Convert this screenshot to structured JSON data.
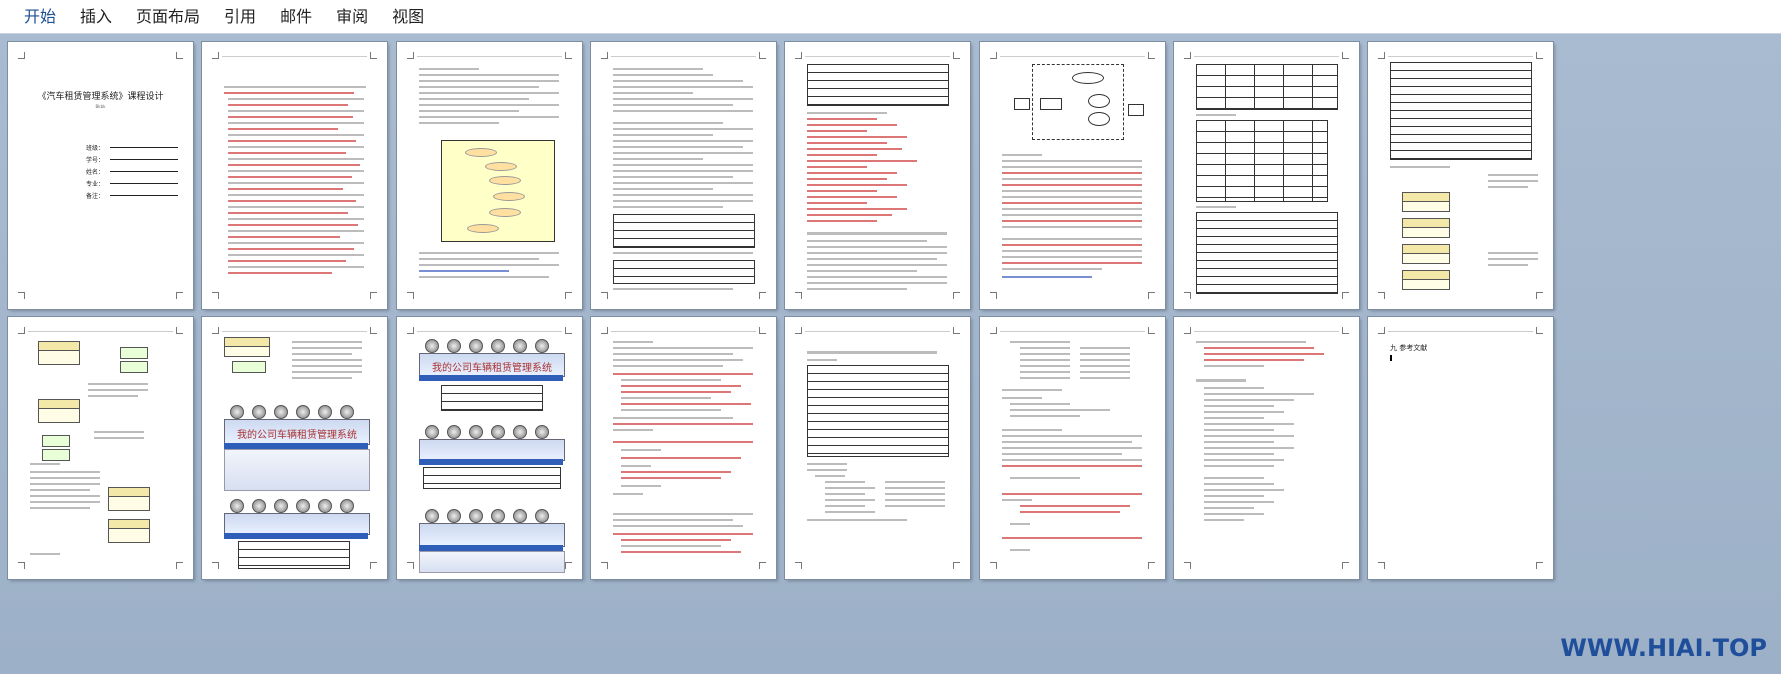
{
  "ribbon": {
    "tabs": [
      "开始",
      "插入",
      "页面布局",
      "引用",
      "邮件",
      "审阅",
      "视图"
    ]
  },
  "cover": {
    "title": "《汽车租赁管理系统》课程设计",
    "subtitle": "Bkbk",
    "fields": [
      "班级：",
      "学号：",
      "姓名：",
      "专业：",
      "备注："
    ]
  },
  "pages": {
    "p9_banner": "我的公司车辆租赁管理系统",
    "p10_banner": "我的公司车辆租赁管理系统",
    "p11_banner": "我的公司车辆租赁管理系统",
    "p16_heading": "九 参考文献"
  },
  "watermark": {
    "text": "WWW.HIAI.TOP"
  }
}
